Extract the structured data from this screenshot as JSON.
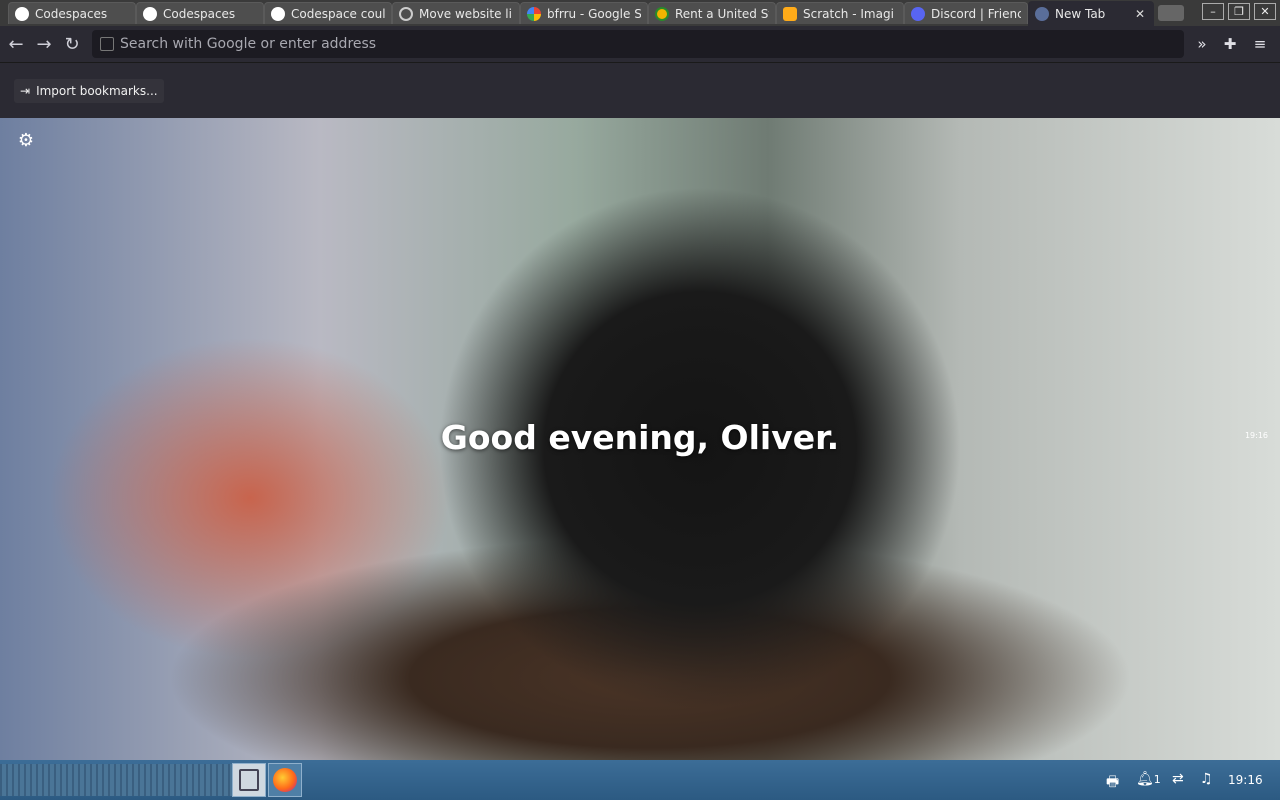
{
  "tabs": [
    {
      "title": "Codespaces",
      "icon": "github-icon",
      "color": "#ffffff"
    },
    {
      "title": "Codespaces",
      "icon": "github-icon",
      "color": "#ffffff"
    },
    {
      "title": "Codespace coul",
      "icon": "github-icon",
      "color": "#ffffff"
    },
    {
      "title": "Move website li",
      "icon": "loading-icon",
      "color": "#cccccc"
    },
    {
      "title": "bfrru - Google S",
      "icon": "google-icon",
      "color": "#4285f4"
    },
    {
      "title": "Rent a United St",
      "icon": "site-icon",
      "color": "#f2b400"
    },
    {
      "title": "Scratch - Imagi",
      "icon": "scratch-icon",
      "color": "#ffab19"
    },
    {
      "title": "Discord | Frienc",
      "icon": "discord-icon",
      "color": "#5865f2"
    },
    {
      "title": "New Tab",
      "icon": "firefox-icon",
      "color": "#5a6e9a"
    }
  ],
  "urlbar": {
    "placeholder": "Search with Google or enter address"
  },
  "bookmarks": {
    "import_label": "Import bookmarks..."
  },
  "newtab": {
    "greeting": "Good evening, Oliver.",
    "camera_time": "19:16"
  },
  "taskbar": {
    "clock": "19:16",
    "notification_count": "1"
  }
}
